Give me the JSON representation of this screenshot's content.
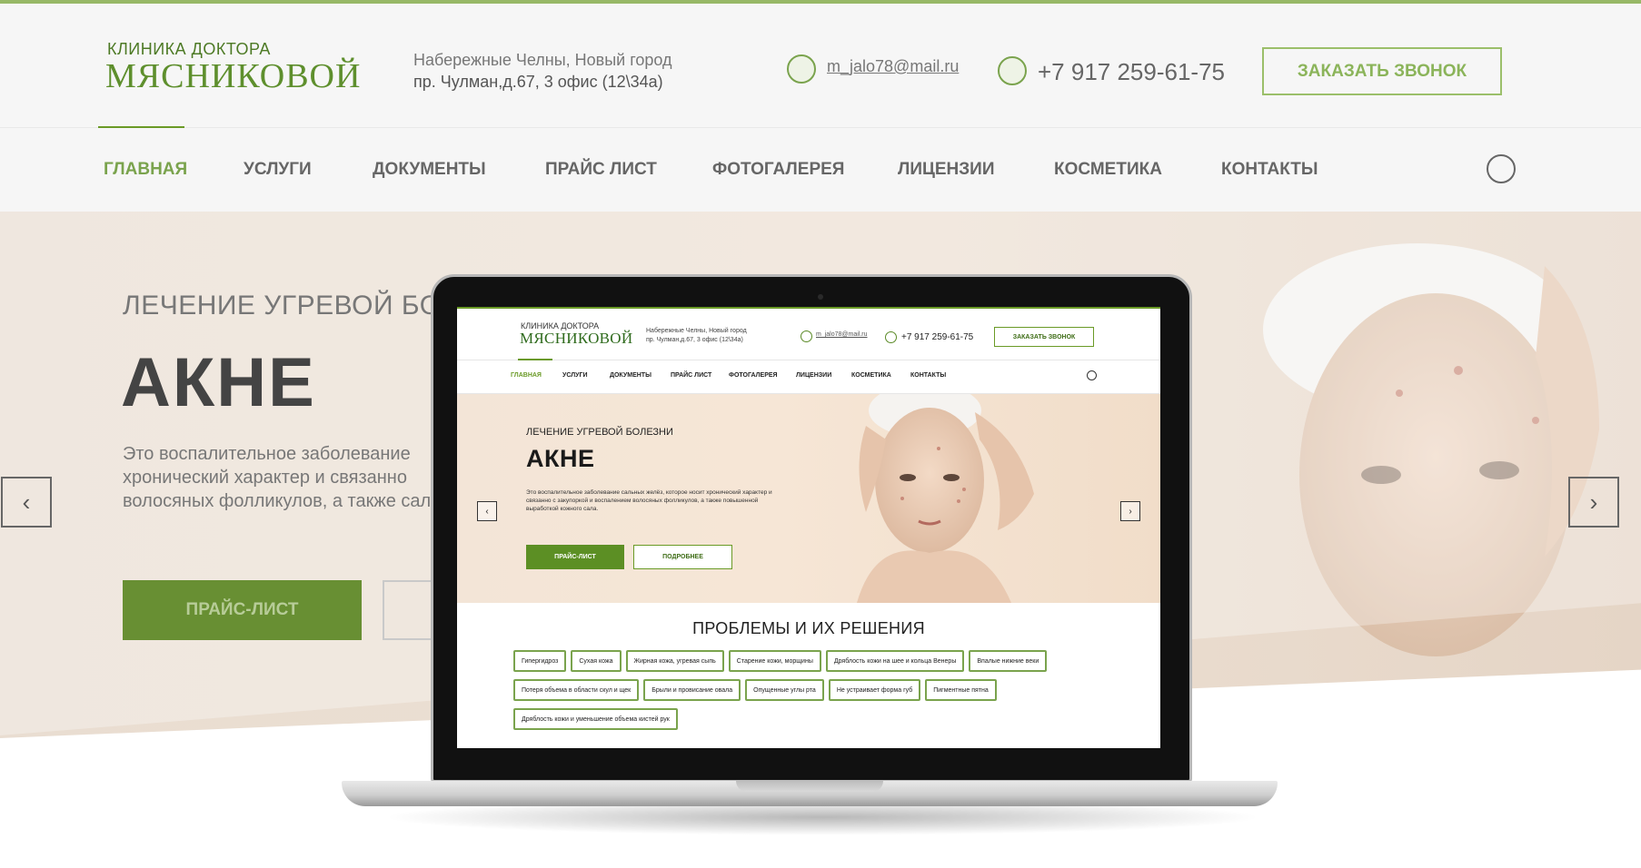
{
  "site": {
    "logo_small": "КЛИНИКА ДОКТОРА",
    "logo_big": "МЯСНИКОВОЙ",
    "address_line1": "Набережные Челны, Новый город",
    "address_line2": "пр. Чулман,д.67, 3 офис (12\\34а)",
    "email": "m_jalo78@mail.ru",
    "phone": "+7 917 259-61-75",
    "call_button": "ЗАКАЗАТЬ ЗВОНОК"
  },
  "nav": {
    "items": [
      {
        "label": "ГЛАВНАЯ",
        "active": true
      },
      {
        "label": "УСЛУГИ"
      },
      {
        "label": "ДОКУМЕНТЫ"
      },
      {
        "label": "ПРАЙС ЛИСТ"
      },
      {
        "label": "ФОТОГАЛЕРЕЯ"
      },
      {
        "label": "ЛИЦЕНЗИИ"
      },
      {
        "label": "КОСМЕТИКА"
      },
      {
        "label": "КОНТАКТЫ"
      }
    ],
    "search_icon": "search-icon"
  },
  "background": {
    "hero_subtitle": "ЛЕЧЕНИЕ УГРЕВОЙ БОЛ",
    "hero_title": "АКНЕ",
    "hero_desc": "Это воспалительное заболевание хронический характер и связанно волосяных фолликулов, а также сала.",
    "button_price": "ПРАЙС-ЛИСТ",
    "arrow_prev": "‹",
    "arrow_next": "›"
  },
  "hero": {
    "subtitle": "ЛЕЧЕНИЕ УГРЕВОЙ БОЛЕЗНИ",
    "title": "АКНЕ",
    "description": "Это воспалительное заболевание сальных желёз, которое носит хронический характер и связанно с закупоркой и воспалением волосяных фолликулов, а также повышенной выработкой кожного сала.",
    "button_price": "ПРАЙС-ЛИСТ",
    "button_more": "ПОДРОБНЕЕ",
    "arrow_prev": "‹",
    "arrow_next": "›"
  },
  "problems": {
    "title": "ПРОБЛЕМЫ И ИХ РЕШЕНИЯ",
    "tags": [
      "Гипергидроз",
      "Сухая кожа",
      "Жирная кожа, угревая сыпь",
      "Старение кожи, морщины",
      "Дряблость кожи на шее и кольца Венеры",
      "Впалые нижние веки",
      "Потеря объема в области скул и щек",
      "Брыли и провисание овала",
      "Опущенные углы рта",
      "Не устраивает форма губ",
      "Пигментные пятна",
      "Дряблость кожи и уменьшение объема кистей рук"
    ]
  },
  "colors": {
    "accent": "#6a9a26",
    "accent_dark": "#3f6d17",
    "hero_bg": "#f3e5d7"
  }
}
